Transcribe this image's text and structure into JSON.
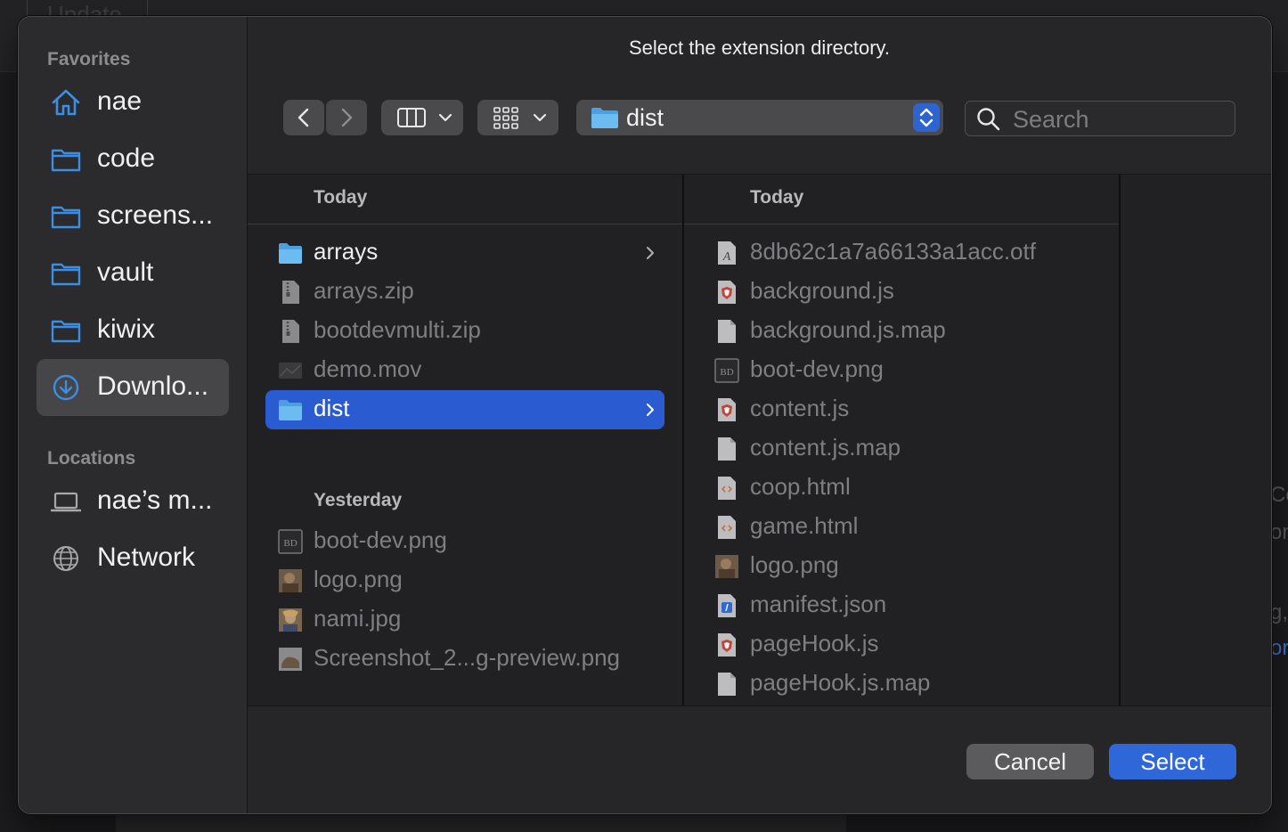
{
  "background": {
    "top_button_label": "Update",
    "right_edge_text": [
      "Co",
      "on",
      "g,",
      "or"
    ]
  },
  "dialog": {
    "title": "Select the extension directory."
  },
  "sidebar": {
    "favorites_label": "Favorites",
    "favorites": [
      {
        "label": "nae",
        "icon": "home-icon"
      },
      {
        "label": "code",
        "icon": "folder-icon"
      },
      {
        "label": "screens...",
        "icon": "folder-icon"
      },
      {
        "label": "vault",
        "icon": "folder-icon"
      },
      {
        "label": "kiwix",
        "icon": "folder-icon"
      },
      {
        "label": "Downlo...",
        "icon": "downloads-icon",
        "selected": true
      }
    ],
    "locations_label": "Locations",
    "locations": [
      {
        "label": "nae’s m...",
        "icon": "laptop-icon"
      },
      {
        "label": "Network",
        "icon": "network-globe-icon"
      }
    ]
  },
  "toolbar": {
    "back_icon": "chevron-left-icon",
    "forward_icon": "chevron-right-icon",
    "column_view_icon": "column-view-icon",
    "group_icon": "grid-icon",
    "current_folder": "dist",
    "search_placeholder": "Search"
  },
  "columns": [
    {
      "header": "Today",
      "items": [
        {
          "name": "arrays",
          "kind": "folder",
          "has_chevron": true
        },
        {
          "name": "arrays.zip",
          "kind": "zip"
        },
        {
          "name": "bootdevmulti.zip",
          "kind": "zip"
        },
        {
          "name": "demo.mov",
          "kind": "movie"
        },
        {
          "name": "dist",
          "kind": "folder",
          "selected": true,
          "has_chevron": true
        }
      ],
      "header2": "Yesterday",
      "items2": [
        {
          "name": "boot-dev.png",
          "kind": "bd-image"
        },
        {
          "name": "logo.png",
          "kind": "photo"
        },
        {
          "name": "nami.jpg",
          "kind": "photo"
        },
        {
          "name": "Screenshot_2...g-preview.png",
          "kind": "photo"
        }
      ]
    },
    {
      "header": "Today",
      "items": [
        {
          "name": "8db62c1a7a66133a1acc.otf",
          "kind": "font"
        },
        {
          "name": "background.js",
          "kind": "brave-js"
        },
        {
          "name": "background.js.map",
          "kind": "doc"
        },
        {
          "name": "boot-dev.png",
          "kind": "bd-image"
        },
        {
          "name": "content.js",
          "kind": "brave-js"
        },
        {
          "name": "content.js.map",
          "kind": "doc"
        },
        {
          "name": "coop.html",
          "kind": "html"
        },
        {
          "name": "game.html",
          "kind": "html"
        },
        {
          "name": "logo.png",
          "kind": "photo"
        },
        {
          "name": "manifest.json",
          "kind": "json"
        },
        {
          "name": "pageHook.js",
          "kind": "brave-js"
        },
        {
          "name": "pageHook.js.map",
          "kind": "doc"
        }
      ]
    }
  ],
  "buttons": {
    "cancel": "Cancel",
    "select": "Select"
  },
  "colors": {
    "accent": "#2f67d8",
    "selection": "#2b5bd0",
    "folder": "#5fb4ec"
  }
}
